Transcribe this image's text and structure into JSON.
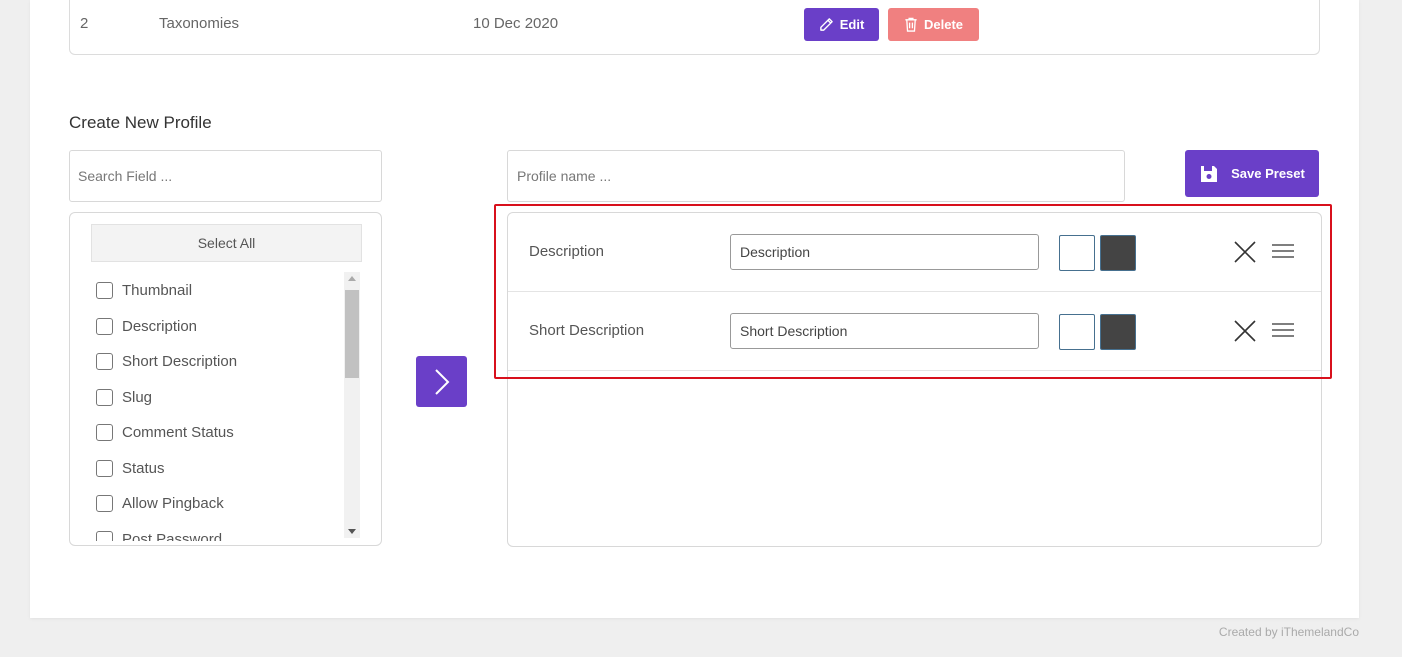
{
  "table": {
    "row": {
      "num": "2",
      "name": "Taxonomies",
      "date": "10 Dec 2020"
    },
    "edit_label": "Edit",
    "delete_label": "Delete"
  },
  "section_title": "Create New Profile",
  "search": {
    "placeholder": "Search Field ..."
  },
  "select_all_label": "Select All",
  "fields": [
    "Thumbnail",
    "Description",
    "Short Description",
    "Slug",
    "Comment Status",
    "Status",
    "Allow Pingback",
    "Post Password"
  ],
  "profile": {
    "placeholder": "Profile name ..."
  },
  "save_preset_label": "Save Preset",
  "selected_fields": [
    {
      "label": "Description",
      "value": "Description"
    },
    {
      "label": "Short Description",
      "value": "Short Description"
    }
  ],
  "colors": {
    "accent": "#6a3fc8",
    "danger": "#f08080",
    "highlight": "#d8101c",
    "swatch_dark": "#444444"
  },
  "footer": "Created by iThemelandCo"
}
